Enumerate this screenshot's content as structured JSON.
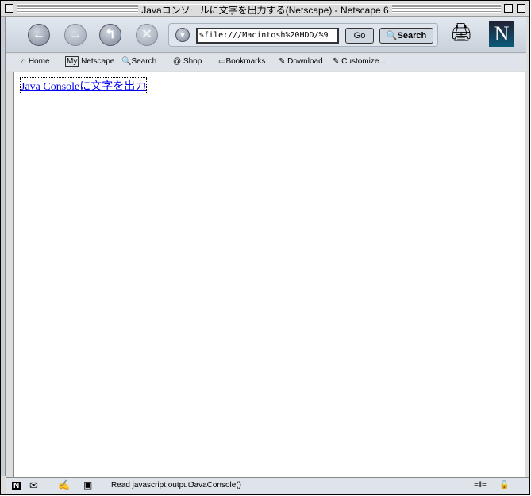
{
  "window": {
    "title": "Javaコンソールに文字を出力する(Netscape) - Netscape 6"
  },
  "nav": {
    "url": "file:///Macintosh%20HDD/%9",
    "go": "Go",
    "search": "Search",
    "logo": "N"
  },
  "personal": [
    {
      "label": "Home",
      "icon": "home-icon"
    },
    {
      "label": "Netscape",
      "icon": "my-netscape-icon",
      "badge": "My"
    },
    {
      "label": "Search",
      "icon": "search-icon"
    },
    {
      "label": "Shop",
      "icon": "shop-icon"
    },
    {
      "label": "Bookmarks",
      "icon": "folder-icon"
    },
    {
      "label": "Download",
      "icon": "bookmark-icon"
    },
    {
      "label": "Customize...",
      "icon": "bookmark-icon"
    }
  ],
  "content": {
    "link": "Java Consoleに文字を出力"
  },
  "status": {
    "text": "Read javascript:outputJavaConsole()",
    "n": "N"
  }
}
